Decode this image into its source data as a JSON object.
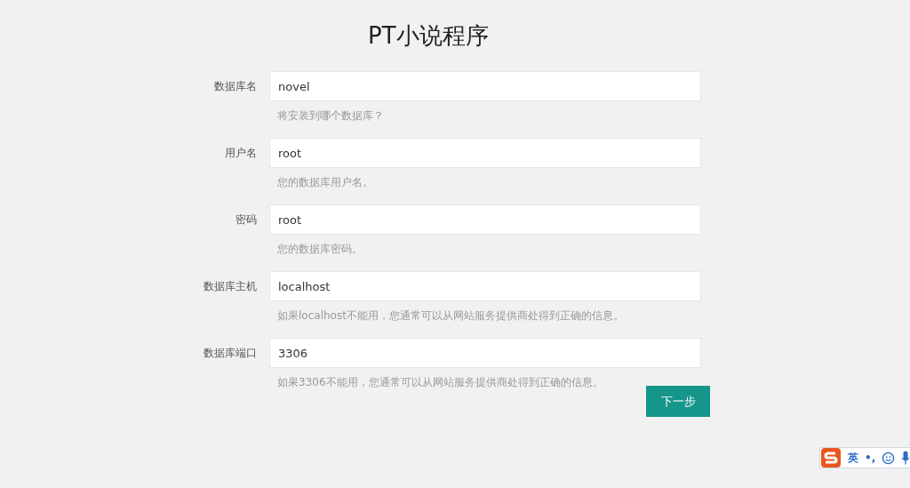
{
  "title": "PT小说程序",
  "fields": [
    {
      "label": "数据库名",
      "value": "novel",
      "hint": "将安装到哪个数据库？"
    },
    {
      "label": "用户名",
      "value": "root",
      "hint": "您的数据库用户名。"
    },
    {
      "label": "密码",
      "value": "root",
      "hint": "您的数据库密码。"
    },
    {
      "label": "数据库主机",
      "value": "localhost",
      "hint": "如果localhost不能用，您通常可以从网站服务提供商处得到正确的信息。"
    },
    {
      "label": "数据库端口",
      "value": "3306",
      "hint": "如果3306不能用，您通常可以从网站服务提供商处得到正确的信息。"
    }
  ],
  "next_button": "下一步",
  "ime_bar": {
    "mode": "英",
    "punctuation": "•,"
  }
}
